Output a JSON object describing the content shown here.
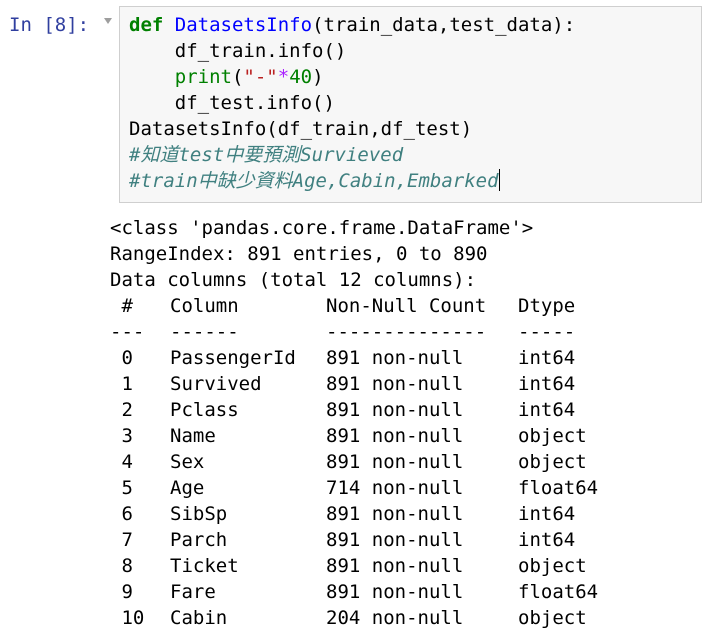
{
  "cell": {
    "prompt": "In [8]:",
    "code": {
      "line1": {
        "kw": "def",
        "name": "DatasetsInfo",
        "args": "(train_data,test_data):"
      },
      "line2": {
        "indent": "    ",
        "text": "df_train.info()"
      },
      "line3": {
        "indent": "    ",
        "fn": "print",
        "open": "(",
        "str": "\"-\"",
        "op": "*",
        "num": "40",
        "close": ")"
      },
      "line4": {
        "indent": "    ",
        "text": "df_test.info()"
      },
      "line5": {
        "text": "DatasetsInfo(df_train,df_test)"
      },
      "line6": {
        "comment": "#知道test中要預測Survieved"
      },
      "line7": {
        "comment": "#train中缺少資料Age,Cabin,Embarked"
      }
    }
  },
  "output": {
    "class_line": "<class 'pandas.core.frame.DataFrame'>",
    "range_index": "RangeIndex: 891 entries, 0 to 890",
    "data_columns": "Data columns (total 12 columns):",
    "header": {
      "idx": " #",
      "column": "Column",
      "count": "Non-Null Count",
      "dtype": "Dtype"
    },
    "separator": {
      "idx": "---",
      "column": "------",
      "count": "--------------",
      "dtype": "-----"
    },
    "rows": [
      {
        "idx": " 0",
        "column": "PassengerId",
        "count": "891 non-null",
        "dtype": "int64"
      },
      {
        "idx": " 1",
        "column": "Survived",
        "count": "891 non-null",
        "dtype": "int64"
      },
      {
        "idx": " 2",
        "column": "Pclass",
        "count": "891 non-null",
        "dtype": "int64"
      },
      {
        "idx": " 3",
        "column": "Name",
        "count": "891 non-null",
        "dtype": "object"
      },
      {
        "idx": " 4",
        "column": "Sex",
        "count": "891 non-null",
        "dtype": "object"
      },
      {
        "idx": " 5",
        "column": "Age",
        "count": "714 non-null",
        "dtype": "float64"
      },
      {
        "idx": " 6",
        "column": "SibSp",
        "count": "891 non-null",
        "dtype": "int64"
      },
      {
        "idx": " 7",
        "column": "Parch",
        "count": "891 non-null",
        "dtype": "int64"
      },
      {
        "idx": " 8",
        "column": "Ticket",
        "count": "891 non-null",
        "dtype": "object"
      },
      {
        "idx": " 9",
        "column": "Fare",
        "count": "891 non-null",
        "dtype": "float64"
      },
      {
        "idx": " 10",
        "column": "Cabin",
        "count": "204 non-null",
        "dtype": "object"
      }
    ]
  },
  "colors": {
    "prompt": "#303f9f",
    "keyword": "#008000",
    "function_name": "#0000ff",
    "string": "#ba2121",
    "operator": "#aa22ff",
    "comment": "#408080",
    "cell_background": "#f7f7f7",
    "cell_border": "#cfcfcf"
  },
  "icons": {
    "collapse": "chevron-down-icon"
  }
}
